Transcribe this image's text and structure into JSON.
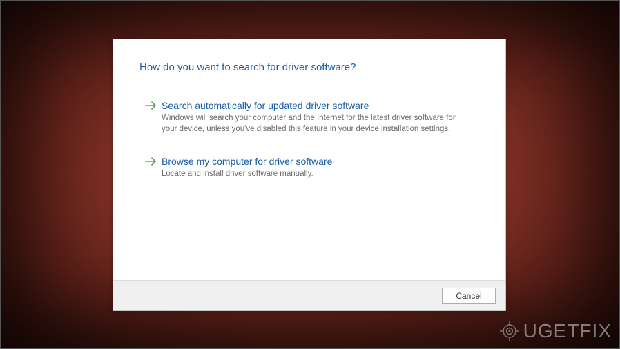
{
  "dialog": {
    "title": "How do you want to search for driver software?",
    "options": [
      {
        "title": "Search automatically for updated driver software",
        "description": "Windows will search your computer and the Internet for the latest driver software for your device, unless you've disabled this feature in your device installation settings."
      },
      {
        "title": "Browse my computer for driver software",
        "description": "Locate and install driver software manually."
      }
    ],
    "cancel_label": "Cancel"
  },
  "watermark": {
    "text": "UGETFIX"
  }
}
